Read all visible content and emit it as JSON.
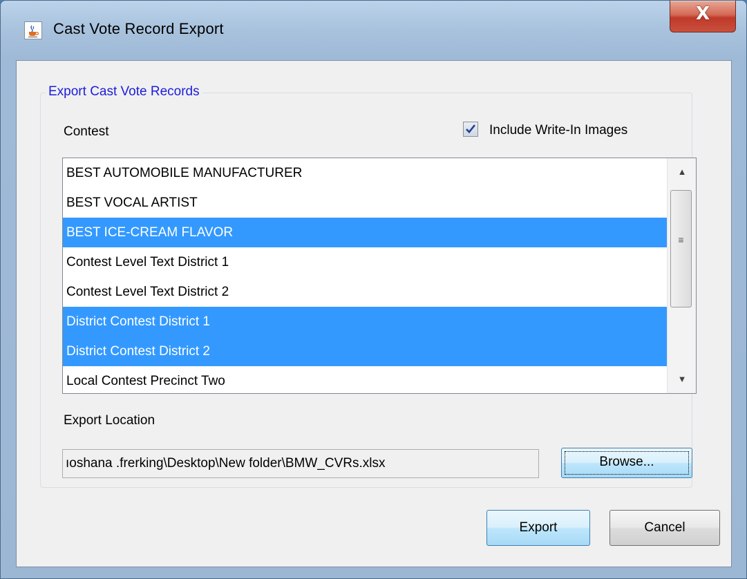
{
  "window": {
    "title": "Cast Vote Record Export",
    "close_label": "X"
  },
  "group": {
    "legend": "Export Cast Vote Records",
    "contest_label": "Contest",
    "include_write_in": {
      "label": "Include Write-In Images",
      "checked": true
    },
    "contests": [
      {
        "label": "BEST AUTOMOBILE MANUFACTURER",
        "selected": false
      },
      {
        "label": "BEST VOCAL ARTIST",
        "selected": false
      },
      {
        "label": "BEST ICE-CREAM FLAVOR",
        "selected": true
      },
      {
        "label": "Contest Level Text District 1",
        "selected": false
      },
      {
        "label": "Contest Level Text District 2",
        "selected": false
      },
      {
        "label": "District Contest District 1",
        "selected": true
      },
      {
        "label": "District Contest District 2",
        "selected": true
      },
      {
        "label": "Local Contest Precinct Two",
        "selected": false
      }
    ],
    "export_location_label": "Export Location",
    "export_path": "ıoshana .frerking\\Desktop\\New folder\\BMW_CVRs.xlsx",
    "browse_label": "Browse..."
  },
  "buttons": {
    "export_label": "Export",
    "cancel_label": "Cancel"
  },
  "icons": {
    "app": "java-cup-icon",
    "scroll_up": "arrow-up-icon",
    "scroll_down": "arrow-down-icon",
    "grip": "scroll-grip-icon"
  },
  "colors": {
    "selection": "#3399ff",
    "legend_text": "#1c1cdc",
    "close_button": "#c0392b"
  }
}
